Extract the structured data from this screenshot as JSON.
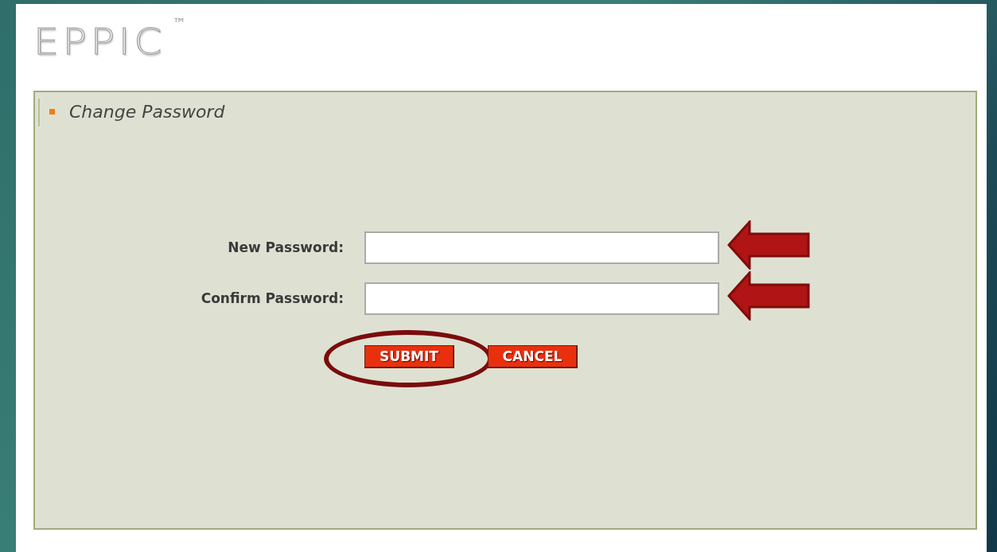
{
  "logo": {
    "text": "EPPIC",
    "trademark": "™"
  },
  "panel": {
    "title": "Change Password",
    "fields": [
      {
        "label": "New Password:"
      },
      {
        "label": "Confirm Password:"
      }
    ],
    "buttons": [
      {
        "label": "SUBMIT",
        "circled": true
      },
      {
        "label": "CANCEL",
        "circled": false
      }
    ]
  }
}
